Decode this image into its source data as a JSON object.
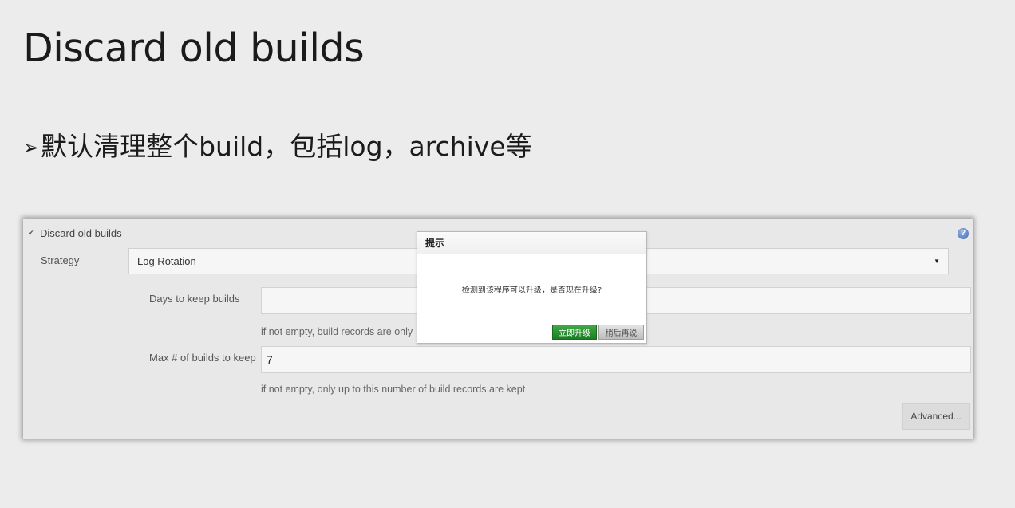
{
  "slide": {
    "title": "Discard old builds",
    "bullet_marker": "➢",
    "bullet_text": "默认清理整个build，包括log，archive等"
  },
  "config_panel": {
    "section_checkbox_label": "Discard old builds",
    "section_checked": true,
    "help_icon_glyph": "?",
    "strategy_label": "Strategy",
    "strategy_value": "Log Rotation",
    "days_label": "Days to keep builds",
    "days_value": "",
    "days_hint": "if not empty, build records are only",
    "max_label": "Max # of builds to keep",
    "max_value": "7",
    "max_hint": "if not empty, only up to this number of build records are kept",
    "advanced_button": "Advanced..."
  },
  "dialog": {
    "title": "提示",
    "message": "检测到该程序可以升级，是否现在升级?",
    "upgrade_button": "立即升级",
    "later_button": "稍后再说"
  },
  "colors": {
    "upgrade_button": "#2a8f31",
    "help_icon": "#3d67b5",
    "background": "#ececec"
  }
}
